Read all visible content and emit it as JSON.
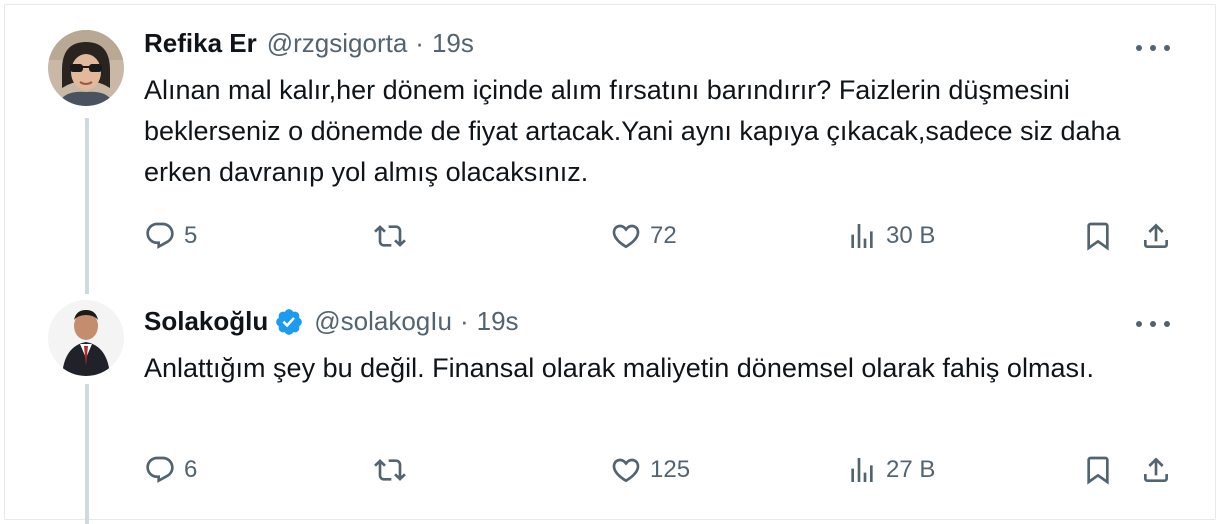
{
  "tweets": [
    {
      "name": "Refika Er",
      "handle": "@rzgsigorta",
      "separator": "·",
      "time": "19s",
      "verified": false,
      "body": "Alınan mal kalır,her dönem içinde alım fırsatını barındırır? Faizlerin düşmesini beklerseniz o dönemde de fiyat artacak.Yani aynı kapıya çıkacak,sadece siz daha erken davranıp yol almış olacaksınız.",
      "replies": "5",
      "likes": "72",
      "views": "30 B"
    },
    {
      "name": "Solakoğlu",
      "handle": "@solakogIu",
      "separator": "·",
      "time": "19s",
      "verified": true,
      "body": "Anlattığım şey bu değil. Finansal olarak maliyetin dönemsel olarak fahiş olması.",
      "replies": "6",
      "likes": "125",
      "views": "27 B"
    }
  ],
  "colors": {
    "text": "#0f1419",
    "muted": "#536471",
    "thread_line": "#cfd9de",
    "verified_badge": "#1d9bf0"
  },
  "icons": [
    "reply-icon",
    "retweet-icon",
    "like-icon",
    "views-icon",
    "bookmark-icon",
    "share-icon",
    "more-icon",
    "verified-badge-icon"
  ]
}
